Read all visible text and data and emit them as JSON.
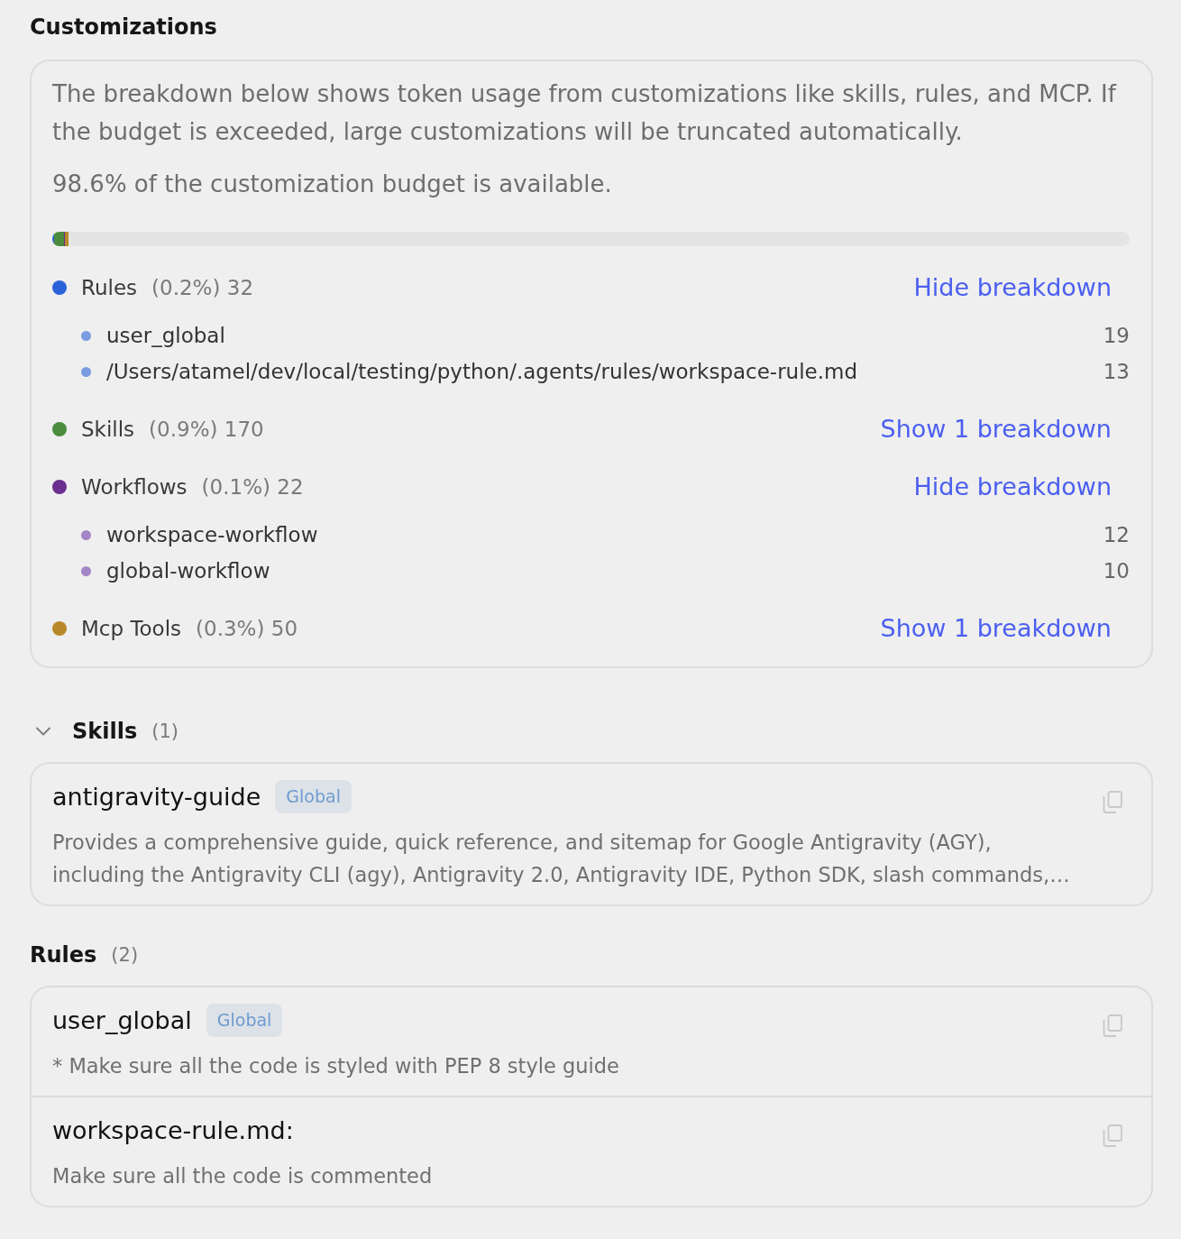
{
  "title": "Customizations",
  "budget": {
    "description": "The breakdown below shows token usage from customizations like skills, rules, and MCP. If the budget is exceeded, large customizations will be truncated automatically.",
    "availability": "98.6% of the customization budget is available.",
    "categories": [
      {
        "name": "Rules",
        "stats": "(0.2%) 32",
        "color": "#2b62d9",
        "level": 0.002,
        "toggle": "Hide breakdown",
        "children": [
          {
            "name": "user_global",
            "count": "19",
            "color": "#7b9ce0"
          },
          {
            "name": "/Users/atamel/dev/local/testing/python/.agents/rules/workspace-rule.md",
            "count": "13",
            "color": "#7b9ce0"
          }
        ]
      },
      {
        "name": "Skills",
        "stats": "(0.9%) 170",
        "color": "#4b8c3f",
        "level": 0.009,
        "toggle": "Show 1 breakdown"
      },
      {
        "name": "Workflows",
        "stats": "(0.1%) 22",
        "color": "#6a2f8f",
        "level": 0.001,
        "toggle": "Hide breakdown",
        "children": [
          {
            "name": "workspace-workflow",
            "count": "12",
            "color": "#a386c8"
          },
          {
            "name": "global-workflow",
            "count": "10",
            "color": "#a386c8"
          }
        ]
      },
      {
        "name": "Mcp Tools",
        "stats": "(0.3%) 50",
        "color": "#b8892a",
        "level": 0.003,
        "toggle": "Show 1 breakdown"
      }
    ]
  },
  "sections": [
    {
      "kind": "collapsible",
      "expanded": true,
      "title": "Skills",
      "count": "(1)",
      "items": [
        {
          "name": "antigravity-guide",
          "badge": "Global",
          "description": "Provides a comprehensive guide, quick reference, and sitemap for Google Antigravity (AGY), including the Antigravity CLI (agy), Antigravity 2.0, Antigravity IDE, Python SDK, slash commands,…"
        }
      ]
    },
    {
      "kind": "plain",
      "title": "Rules",
      "count": "(2)",
      "items": [
        {
          "name": "user_global",
          "badge": "Global",
          "description": "* Make sure all the code is styled with PEP 8 style guide"
        },
        {
          "name": "workspace-rule.md:",
          "description": "Make sure all the code is commented"
        }
      ]
    }
  ]
}
